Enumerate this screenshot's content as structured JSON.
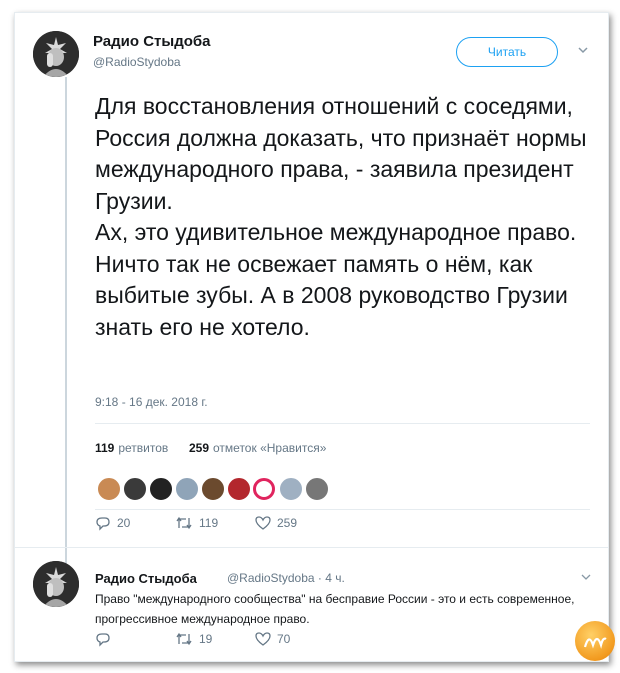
{
  "tweet": {
    "author_name": "Радио Стыдоба",
    "author_handle": "@RadioStydoba",
    "follow_label": "Читать",
    "text": "Для восстановления отношений с соседями, Россия должна доказать, что признаёт нормы международного права, - заявила президент Грузии.\nАх, это удивительное международное право. Ничто так не освежает память о нём, как выбитые зубы. А в 2008 руководство Грузии знать его не хотело.",
    "timestamp": "9:18 - 16 дек. 2018 г.",
    "retweets_count": "119",
    "retweets_label": "ретвитов",
    "likes_count": "259",
    "likes_label": "отметок «Нравится»",
    "actions": {
      "replies": "20",
      "retweets": "119",
      "likes": "259"
    }
  },
  "reply": {
    "author_name": "Радио Стыдоба",
    "meta": "@RadioStydoba · 4 ч.",
    "text": "Право \"международного сообщества\" на бесправие России - это и есть современное, прогрессивное международное право.",
    "actions": {
      "replies": "",
      "retweets": "19",
      "likes": "70"
    }
  },
  "liker_colors": [
    "#c98a54",
    "#3a3a3a",
    "#222222",
    "#8fa4b8",
    "#6b4a2e",
    "#b3272d",
    "#e0245e",
    "#9fb0c2",
    "#777777"
  ],
  "colors": {
    "accent": "#1da1f2",
    "muted": "#657786",
    "text": "#14171a"
  }
}
